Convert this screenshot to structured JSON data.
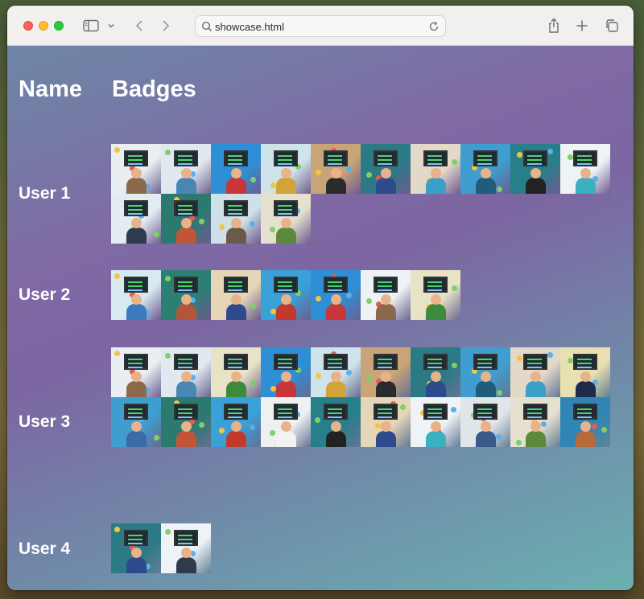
{
  "browser": {
    "url": "showcase.html"
  },
  "table": {
    "headers": {
      "name": "Name",
      "badges": "Badges"
    },
    "users": [
      {
        "name": "User 1",
        "badges": [
          {
            "theme": "#e9eef2",
            "shirt": "#8a6a4a"
          },
          {
            "theme": "#dfe9ef",
            "shirt": "#4a86b4"
          },
          {
            "theme": "#2e8fd6",
            "shirt": "#c8363a"
          },
          {
            "theme": "#cfe3ea",
            "shirt": "#d3a43a"
          },
          {
            "theme": "#c9a478",
            "shirt": "#2b2b2b"
          },
          {
            "theme": "#2b7a86",
            "shirt": "#2d4a8c"
          },
          {
            "theme": "#e3d9c8",
            "shirt": "#3aa0c8"
          },
          {
            "theme": "#3f9ecf",
            "shirt": "#1f5d7a"
          },
          {
            "theme": "#277f8a",
            "shirt": "#222222"
          },
          {
            "theme": "#eef3f6",
            "shirt": "#3bb0c0"
          },
          {
            "theme": "#e2ecf1",
            "shirt": "#2d3b4f"
          },
          {
            "theme": "#2a7a6f",
            "shirt": "#c0553a"
          },
          {
            "theme": "#cfe1e8",
            "shirt": "#6a5a4a"
          },
          {
            "theme": "#e6e0cf",
            "shirt": "#5c8a3c"
          }
        ]
      },
      {
        "name": "User 2",
        "badges": [
          {
            "theme": "#d8eaf0",
            "shirt": "#3a7abf"
          },
          {
            "theme": "#2b7f73",
            "shirt": "#b4553a"
          },
          {
            "theme": "#e5d6b8",
            "shirt": "#2d4a8c"
          },
          {
            "theme": "#3aa0d8",
            "shirt": "#c23a2e"
          },
          {
            "theme": "#2e8fd6",
            "shirt": "#c8363a"
          },
          {
            "theme": "#eef2f4",
            "shirt": "#8a6a4a"
          },
          {
            "theme": "#e8e2c6",
            "shirt": "#3c8a3c"
          }
        ]
      },
      {
        "name": "User 3",
        "badges": [
          {
            "theme": "#e9eef2",
            "shirt": "#8a6a4a"
          },
          {
            "theme": "#dfe9ef",
            "shirt": "#4a86b4"
          },
          {
            "theme": "#e8e2c6",
            "shirt": "#3c8a3c"
          },
          {
            "theme": "#2e8fd6",
            "shirt": "#c8363a"
          },
          {
            "theme": "#cfe3ea",
            "shirt": "#d3a43a"
          },
          {
            "theme": "#c9a478",
            "shirt": "#2b2b2b"
          },
          {
            "theme": "#2b7a86",
            "shirt": "#2d4a8c"
          },
          {
            "theme": "#3f9ecf",
            "shirt": "#1f5d7a"
          },
          {
            "theme": "#e3d9c8",
            "shirt": "#3aa0c8"
          },
          {
            "theme": "#e8e0b0",
            "shirt": "#1e2a4a"
          },
          {
            "theme": "#3f9ecf",
            "shirt": "#3b6aa8"
          },
          {
            "theme": "#2a7a6f",
            "shirt": "#c0553a"
          },
          {
            "theme": "#3aa0d8",
            "shirt": "#c23a2e"
          },
          {
            "theme": "#eef0f2",
            "shirt": "#f2f2f2"
          },
          {
            "theme": "#277f8a",
            "shirt": "#222222"
          },
          {
            "theme": "#e5d6b8",
            "shirt": "#2d4a8c"
          },
          {
            "theme": "#eef3f6",
            "shirt": "#3bb0c0"
          },
          {
            "theme": "#dfe6ea",
            "shirt": "#3a5a8a"
          },
          {
            "theme": "#e6e0cf",
            "shirt": "#5c8a3c"
          },
          {
            "theme": "#2f86b4",
            "shirt": "#b46a3a"
          }
        ]
      },
      {
        "name": "User 4",
        "badges": [
          {
            "theme": "#2b7a86",
            "shirt": "#2d4a8c"
          },
          {
            "theme": "#eef3f6",
            "shirt": "#2d3b4f"
          }
        ]
      }
    ]
  }
}
